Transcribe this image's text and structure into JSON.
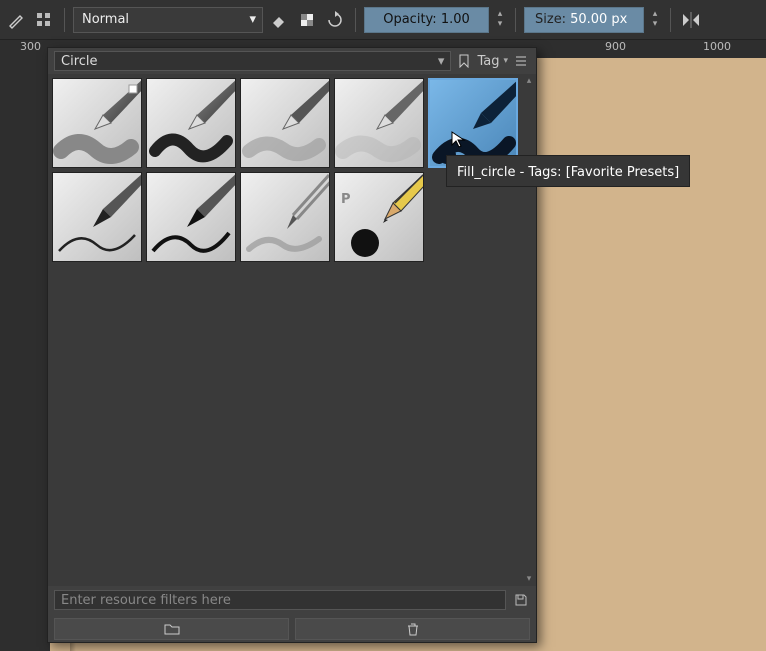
{
  "toolbar": {
    "blend_mode": "Normal",
    "opacity_label": "Opacity:",
    "opacity_value": "1.00",
    "size_label": "Size:",
    "size_value": "50.00 px"
  },
  "ruler": {
    "marks": [
      "300",
      "900",
      "1000"
    ]
  },
  "panel": {
    "search_value": "Circle",
    "tag_label": "Tag",
    "filter_placeholder": "Enter resource filters here",
    "presets": [
      {
        "id": "basic5-circle",
        "selected": false
      },
      {
        "id": "basic5-tilt",
        "selected": false
      },
      {
        "id": "basic5-soft",
        "selected": false
      },
      {
        "id": "basic5-softer",
        "selected": false
      },
      {
        "id": "fill-circle",
        "selected": true
      },
      {
        "id": "ink-pen-thin",
        "selected": false
      },
      {
        "id": "ink-pen",
        "selected": false
      },
      {
        "id": "layout-pencil",
        "selected": false
      },
      {
        "id": "pencil-hb",
        "selected": false
      }
    ]
  },
  "tooltip": {
    "text": "Fill_circle - Tags: [Favorite Presets]"
  }
}
